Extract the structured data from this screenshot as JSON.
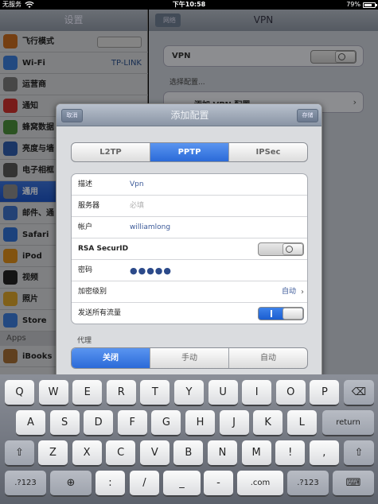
{
  "status": {
    "carrier": "无服务",
    "time": "下午10:58",
    "battery": "79%",
    "battery_level": 0.79
  },
  "settings": {
    "title": "设置",
    "items": [
      {
        "label": "飞行模式"
      },
      {
        "label": "Wi-Fi",
        "value": "TP-LINK"
      },
      {
        "label": "运营商"
      },
      {
        "label": "通知"
      },
      {
        "label": "蜂窝数据"
      },
      {
        "label": "亮度与墙"
      },
      {
        "label": "电子相框"
      },
      {
        "label": "通用"
      },
      {
        "label": "邮件、通"
      },
      {
        "label": "Safari"
      },
      {
        "label": "iPod"
      },
      {
        "label": "视频"
      },
      {
        "label": "照片"
      },
      {
        "label": "Store"
      }
    ],
    "apps_header": "Apps",
    "apps": [
      {
        "label": "iBooks"
      }
    ]
  },
  "vpn": {
    "title": "VPN",
    "back": "网络",
    "vpn_label": "VPN",
    "choose_config": "选择配置...",
    "add_config": "添加 VPN 配置..."
  },
  "modal": {
    "title": "添加配置",
    "cancel": "取消",
    "save": "存储",
    "types": [
      "L2TP",
      "PPTP",
      "IPSec"
    ],
    "selected_type": 1,
    "fields": {
      "description_label": "描述",
      "description_value": "Vpn",
      "server_label": "服务器",
      "server_placeholder": "必填",
      "account_label": "帐户",
      "account_value": "williamlong",
      "rsa_label": "RSA SecurID",
      "password_label": "密码",
      "password_value": "●●●●●",
      "encryption_label": "加密级别",
      "encryption_value": "自动",
      "send_all_label": "发送所有流量"
    },
    "proxy_label": "代理",
    "proxy_options": [
      "关闭",
      "手动",
      "自动"
    ],
    "proxy_selected": 0
  },
  "keyboard": {
    "row1": [
      "Q",
      "W",
      "E",
      "R",
      "T",
      "Y",
      "U",
      "I",
      "O",
      "P"
    ],
    "row2": [
      "A",
      "S",
      "D",
      "F",
      "G",
      "H",
      "J",
      "K",
      "L"
    ],
    "return": "return",
    "row3": [
      "Z",
      "X",
      "C",
      "V",
      "B",
      "N",
      "M",
      "!",
      ","
    ],
    "row4": {
      "numbers": ".?123",
      "slash": "/",
      "dash": "-",
      "com": ".com"
    },
    "icons": {
      "backspace": "backspace-icon",
      "shift": "shift-icon",
      "globe": "globe-icon",
      "hide": "keyboard-hide-icon"
    }
  }
}
